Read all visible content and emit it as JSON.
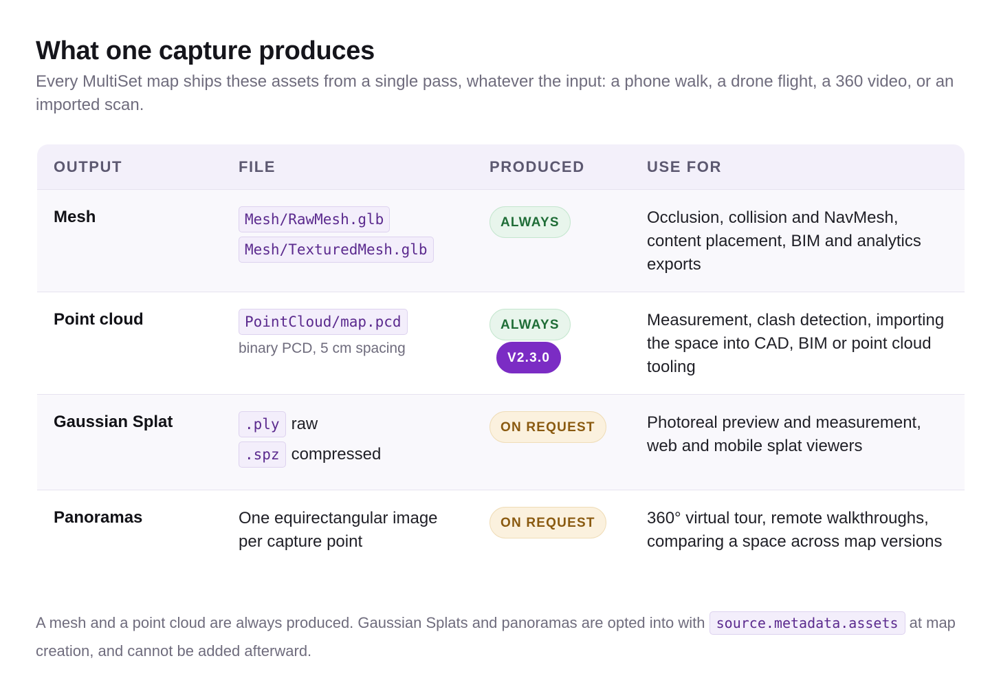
{
  "header": {
    "title": "What one capture produces",
    "intro": "Every MultiSet map ships these assets from a single pass, whatever the input: a phone walk, a drone flight, a 360 video, or an imported scan."
  },
  "table": {
    "columns": [
      "OUTPUT",
      "FILE",
      "PRODUCED",
      "USE FOR"
    ],
    "rows": [
      {
        "output": "Mesh",
        "files": [
          "Mesh/RawMesh.glb",
          "Mesh/TexturedMesh.glb"
        ],
        "produced": "ALWAYS",
        "use": "Occlusion, collision and NavMesh, content placement, BIM and analytics exports"
      },
      {
        "output": "Point cloud",
        "file": "PointCloud/map.pcd",
        "file_note": "binary PCD, 5 cm spacing",
        "produced": "ALWAYS",
        "version_badge": "V2.3.0",
        "use": "Measurement, clash detection, importing the space into CAD, BIM or point cloud tooling"
      },
      {
        "output": "Gaussian Splat",
        "files": [
          {
            "code": ".ply",
            "label": "raw"
          },
          {
            "code": ".spz",
            "label": "compressed"
          }
        ],
        "produced": "ON REQUEST",
        "use": "Photoreal preview and measurement, web and mobile splat viewers"
      },
      {
        "output": "Panoramas",
        "file_text": "One equirectangular image per capture point",
        "produced": "ON REQUEST",
        "use": "360° virtual tour, remote walkthroughs, comparing a space across map versions"
      }
    ]
  },
  "footer": {
    "before": "A mesh and a point cloud are always produced. Gaussian Splats and panoramas are opted into with",
    "code": "source.metadata.assets",
    "after": "at map creation, and cannot be added afterward."
  },
  "colors": {
    "always": "#1f6d37",
    "on_request": "#8a5a10",
    "version": "#7b2cc4",
    "code": "#5b2a8e"
  }
}
